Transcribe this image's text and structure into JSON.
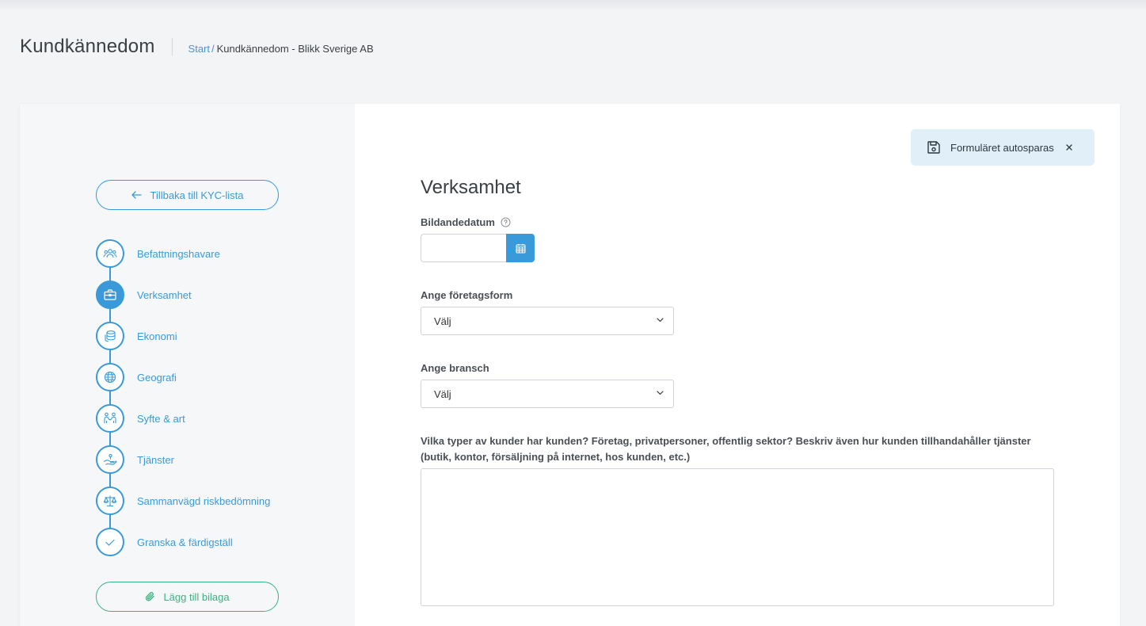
{
  "header": {
    "title": "Kundkännedom",
    "breadcrumb": {
      "start": "Start",
      "separator": "/",
      "current": "Kundkännedom - Blikk Sverige AB"
    }
  },
  "sidebar": {
    "back_button": "Tillbaka till KYC-lista",
    "steps": [
      {
        "label": "Befattningshavare",
        "icon": "people-icon",
        "active": false
      },
      {
        "label": "Verksamhet",
        "icon": "briefcase-icon",
        "active": true
      },
      {
        "label": "Ekonomi",
        "icon": "coins-icon",
        "active": false
      },
      {
        "label": "Geografi",
        "icon": "globe-icon",
        "active": false
      },
      {
        "label": "Syfte & art",
        "icon": "handshake-people-icon",
        "active": false
      },
      {
        "label": "Tjänster",
        "icon": "hand-service-icon",
        "active": false
      },
      {
        "label": "Sammanvägd riskbedömning",
        "icon": "scale-icon",
        "active": false
      },
      {
        "label": "Granska & färdigställ",
        "icon": "check-icon",
        "active": false
      }
    ],
    "attach_button": "Lägg till bilaga"
  },
  "autosave": {
    "text": "Formuläret autosparas",
    "icon": "save-icon"
  },
  "form": {
    "section_title": "Verksamhet",
    "founding_date": {
      "label": "Bildandedatum",
      "value": ""
    },
    "company_form": {
      "label": "Ange företagsform",
      "value": "Välj"
    },
    "industry": {
      "label": "Ange bransch",
      "value": "Välj"
    },
    "customer_types": {
      "label": "Vilka typer av kunder har kunden? Företag, privatpersoner, offentlig sektor? Beskriv även hur kunden tillhandahåller tjänster (butik, kontor, försäljning på internet, hos kunden, etc.)",
      "value": ""
    }
  },
  "colors": {
    "accent": "#3a9ad9",
    "attach": "#3db17f",
    "autosave_bg": "#e1eff9"
  }
}
